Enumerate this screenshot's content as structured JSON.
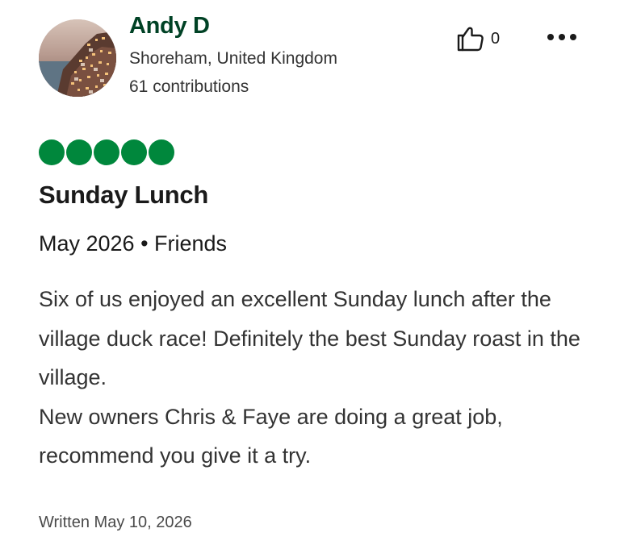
{
  "reviewer": {
    "name": "Andy D",
    "location": "Shoreham, United Kingdom",
    "contributions": "61 contributions",
    "avatar_icon": "avatar-photo"
  },
  "actions": {
    "helpful_count": "0",
    "helpful_icon": "thumbs-up-icon",
    "more_icon": "more-options-icon"
  },
  "rating": {
    "value": 5,
    "max": 5,
    "color": "#00873c"
  },
  "review": {
    "title": "Sunday Lunch",
    "trip_meta": "May 2026 • Friends",
    "body": [
      "Six of us enjoyed an excellent Sunday lunch after the village duck race! Definitely the best Sunday roast in the village.",
      "New owners Chris & Faye are doing a great job, recommend you give it a try."
    ],
    "written": "Written May 10, 2026"
  },
  "colors": {
    "brand_dark_green": "#004225",
    "bubble_green": "#00873c"
  }
}
